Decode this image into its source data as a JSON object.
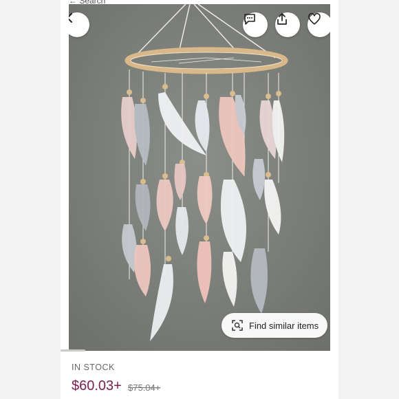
{
  "top_bar": {
    "search_stub": "← Search"
  },
  "product_image": {
    "description_icon": "feather-mobile-image",
    "find_similar_label": "Find similar items"
  },
  "icons": {
    "back": "chevron-left-icon",
    "feedback": "message-icon",
    "share": "share-icon",
    "favorite": "heart-icon",
    "visual_search": "camera-search-icon"
  },
  "listing": {
    "stock_status": "IN STOCK",
    "price": "$60.03+",
    "original_price": "$75.04+"
  },
  "colors": {
    "price": "#7a1f4f",
    "background": "#f3f3f3"
  }
}
